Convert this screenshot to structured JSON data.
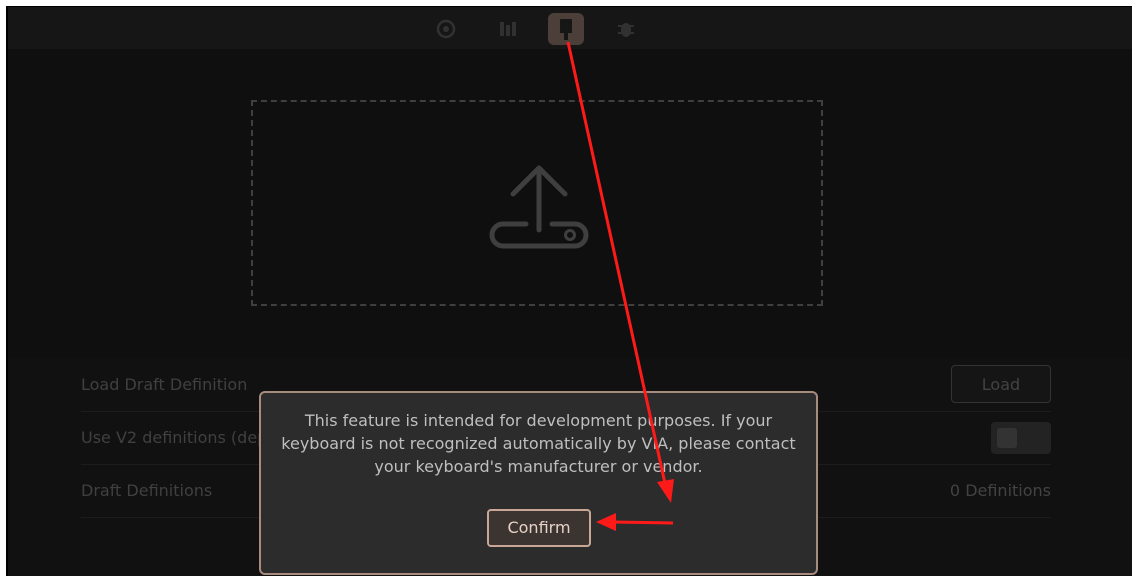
{
  "topbar": {
    "icons": [
      {
        "name": "settings-icon",
        "active": false
      },
      {
        "name": "keyboard-icon",
        "active": false
      },
      {
        "name": "paintbrush-icon",
        "active": true
      },
      {
        "name": "debug-icon",
        "active": false
      }
    ]
  },
  "dropzone": {
    "icon": "upload-icon"
  },
  "settings": {
    "rows": [
      {
        "label": "Load Draft Definition",
        "control": "Load"
      },
      {
        "label": "Use V2 definitions (deprecated)",
        "control": "toggle",
        "value": false
      },
      {
        "label": "Draft Definitions",
        "value": "0 Definitions"
      }
    ]
  },
  "modal": {
    "message": "This feature is intended for development purposes. If your keyboard is not recognized automatically by VIA, please contact your keyboard's manufacturer or vendor.",
    "confirm_label": "Confirm"
  },
  "colors": {
    "background": "#121212",
    "accent": "#c9a797",
    "annotation_arrow": "#ff1a1a"
  }
}
